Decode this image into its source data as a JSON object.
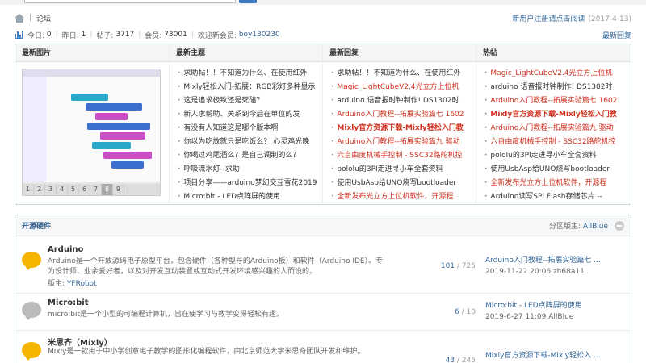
{
  "breadcrumb": {
    "current": "论坛",
    "notice": "新用户注册请点击阅读",
    "notice_date": "(2017-4-13)"
  },
  "stats": {
    "today_label": "今日:",
    "today": "0",
    "yesterday_label": "昨日:",
    "yesterday": "1",
    "posts_label": "帖子:",
    "posts": "3717",
    "members_label": "会员:",
    "members": "73001",
    "welcome_label": "欢迎新会员:",
    "new_member": "boy130230",
    "latest_reply": "最新回复"
  },
  "box": {
    "col_titles": [
      "最新图片",
      "最新主题",
      "最新回复",
      "热帖"
    ],
    "pager": [
      "1",
      "2",
      "3",
      "4",
      "5",
      "6",
      "7",
      "8",
      "9"
    ],
    "pager_active": 8,
    "new_topics": [
      {
        "text": "求助帖！！不知道为什么、在使用红外",
        "style": ""
      },
      {
        "text": "Mixly轻松入门-拓展：RGB彩灯多种显示",
        "style": ""
      },
      {
        "text": "这是追求极致还是死磕？",
        "style": ""
      },
      {
        "text": "新人求帮助、关系到今后在单位的发",
        "style": ""
      },
      {
        "text": "有没有人知道这是哪个版本啊",
        "style": ""
      },
      {
        "text": "你以为吃放就只是吃饭么？ 心灵鸡光晚",
        "style": ""
      },
      {
        "text": "你喝过鸡尾酒么？是自己调制的么？",
        "style": ""
      },
      {
        "text": "呼吸流水灯--求助",
        "style": ""
      },
      {
        "text": "项目分享——arduino梦幻交互雪花2019",
        "style": ""
      },
      {
        "text": "Micro:bit - LED点阵屏的使用",
        "style": ""
      }
    ],
    "new_replies": [
      {
        "text": "求助帖！！不知道为什么、在使用红外",
        "style": ""
      },
      {
        "text": "Magic_LightCubeV2.4光立方上位机",
        "style": "red"
      },
      {
        "text": "arduino 语音报时钟制作! DS1302时",
        "style": ""
      },
      {
        "text": "Arduino入门教程--拓展实验篇七 1602",
        "style": "red"
      },
      {
        "text": "Mixly官方资源下载-Mixly轻松入门教",
        "style": "red bold"
      },
      {
        "text": "Arduino入门教程--拓展实验篇九 驱动",
        "style": "red"
      },
      {
        "text": "六自由度机械手控制 - SSC32路舵机控",
        "style": "red"
      },
      {
        "text": "pololu的3PI走进寻小车全套资料",
        "style": ""
      },
      {
        "text": "使用UsbAsp给UNO烧写bootloader",
        "style": ""
      },
      {
        "text": "全新发布光立方上位机软件，开源程",
        "style": "red"
      }
    ],
    "hot_posts": [
      {
        "text": "Magic_LightCubeV2.4光立方上位机",
        "style": "red"
      },
      {
        "text": "arduino 语音报时钟制作! DS1302时",
        "style": ""
      },
      {
        "text": "Arduino入门教程--拓展实验篇七 1602",
        "style": "red"
      },
      {
        "text": "Mixly官方资源下载-Mixly轻松入门教",
        "style": "red bold"
      },
      {
        "text": "Arduino入门教程--拓展实验篇九 驱动",
        "style": "red"
      },
      {
        "text": "六自由度机械手控制 - SSC32路舵机控",
        "style": "red"
      },
      {
        "text": "pololu的3PI走进寻小车全套资料",
        "style": ""
      },
      {
        "text": "使用UsbAsp给UNO烧写bootloader",
        "style": ""
      },
      {
        "text": "全新发布光立方上位机软件，开源程",
        "style": "red"
      },
      {
        "text": "Arduino读写SPI Flash存储芯片 --",
        "style": ""
      }
    ]
  },
  "forum": {
    "title": "开源硬件",
    "mod_label": "分区版主:",
    "mod_name": "AllBlue",
    "boards": [
      {
        "name": "Arduino",
        "desc": "Arduino是一个开放源码电子原型平台，包含硬件（各种型号的Arduino板）和软件（Arduino IDE）。专为设计师、业余爱好者，以及对开发互动装置或互动式开发环境感兴趣的人而设的。",
        "mod_label": "版主:",
        "mod": "YFRobot",
        "topics": "101",
        "posts": "725",
        "last_title": "Arduino入门教程--拓展实验篇七 ...",
        "last_meta": "2019-11-22 20:06 zh68a11",
        "icon": "yellow"
      },
      {
        "name": "Micro:bit",
        "desc": "micro:bit是一个小型的可编程计算机，旨在使学习与教学变得轻松有趣。",
        "mod_label": "",
        "mod": "",
        "topics": "6",
        "posts": "10",
        "last_title": "Micro:bit - LED点阵屏的使用",
        "last_meta": "2019-6-27 11:09 AllBlue",
        "icon": "gray"
      },
      {
        "name": "米思齐（Mixly）",
        "desc": "Mixly是一款用于中小学创意电子教学的图形化编程软件，由北京师范大学米思奇团队开发和维护。",
        "mod_label": "",
        "mod": "",
        "topics": "43",
        "posts": "245",
        "last_title": "Mixly官方资源下载-Mixly轻松入 ...",
        "last_meta": "",
        "icon": "yellow"
      }
    ]
  }
}
